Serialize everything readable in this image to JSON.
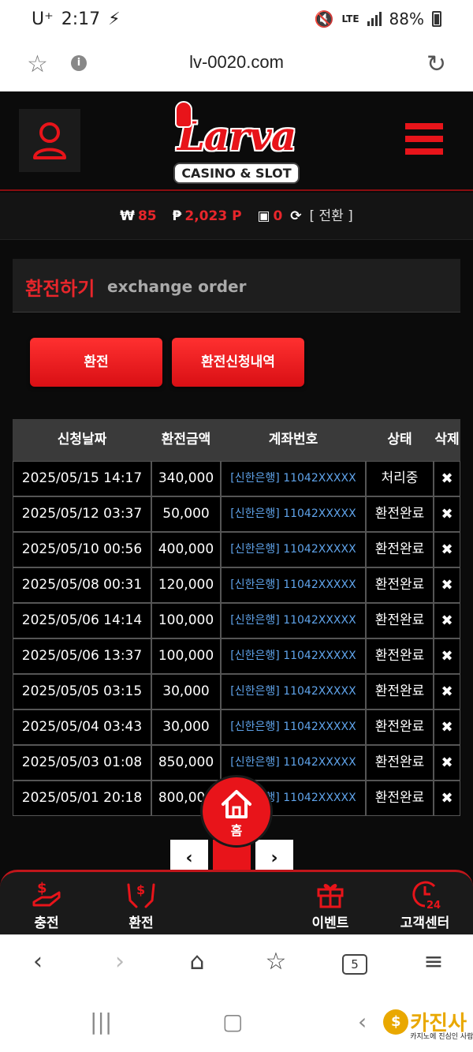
{
  "status": {
    "carrier": "U⁺",
    "time": "2:17",
    "network": "LTE",
    "battery": "88%"
  },
  "browser": {
    "url": "lv-0020.com"
  },
  "header": {
    "logo_text": "Larva",
    "logo_sub": "CASINO & SLOT"
  },
  "wallet": {
    "won_symbol": "₩",
    "won_value": "85",
    "point_symbol": "₱",
    "point_value": "2,023 P",
    "chip_value": "0",
    "convert_label": "[ 전환 ]"
  },
  "section": {
    "title_ko": "환전하기",
    "title_en": "exchange order"
  },
  "buttons": {
    "exchange": "환전",
    "history": "환전신청내역"
  },
  "table": {
    "headers": [
      "신청날짜",
      "환전금액",
      "계좌번호",
      "상태",
      "삭제"
    ],
    "rows": [
      {
        "date": "2025/05/15 14:17",
        "amount": "340,000",
        "account": "[신한은행] 11042XXXXX",
        "status": "처리중",
        "delete": "✖"
      },
      {
        "date": "2025/05/12 03:37",
        "amount": "50,000",
        "account": "[신한은행] 11042XXXXX",
        "status": "환전완료",
        "delete": "✖"
      },
      {
        "date": "2025/05/10 00:56",
        "amount": "400,000",
        "account": "[신한은행] 11042XXXXX",
        "status": "환전완료",
        "delete": "✖"
      },
      {
        "date": "2025/05/08 00:31",
        "amount": "120,000",
        "account": "[신한은행] 11042XXXXX",
        "status": "환전완료",
        "delete": "✖"
      },
      {
        "date": "2025/05/06 14:14",
        "amount": "100,000",
        "account": "[신한은행] 11042XXXXX",
        "status": "환전완료",
        "delete": "✖"
      },
      {
        "date": "2025/05/06 13:37",
        "amount": "100,000",
        "account": "[신한은행] 11042XXXXX",
        "status": "환전완료",
        "delete": "✖"
      },
      {
        "date": "2025/05/05 03:15",
        "amount": "30,000",
        "account": "[신한은행] 11042XXXXX",
        "status": "환전완료",
        "delete": "✖"
      },
      {
        "date": "2025/05/04 03:43",
        "amount": "30,000",
        "account": "[신한은행] 11042XXXXX",
        "status": "환전완료",
        "delete": "✖"
      },
      {
        "date": "2025/05/03 01:08",
        "amount": "850,000",
        "account": "[신한은행] 11042XXXXX",
        "status": "환전완료",
        "delete": "✖"
      },
      {
        "date": "2025/05/01 20:18",
        "amount": "800,000",
        "account": "[신한은행] 11042XXXXX",
        "status": "환전완료",
        "delete": "✖"
      }
    ]
  },
  "pager": {
    "prev": "‹",
    "current": "",
    "next": "›"
  },
  "nav": {
    "charge": "충전",
    "exchange": "환전",
    "home": "홈",
    "event": "이벤트",
    "support": "고객센터"
  },
  "watermark": {
    "text": "카진사",
    "sub": "카지노에 진심인 사람들"
  },
  "colors": {
    "accent": "#e8141a",
    "link": "#5fa3ea",
    "background": "#0b0b0b"
  }
}
